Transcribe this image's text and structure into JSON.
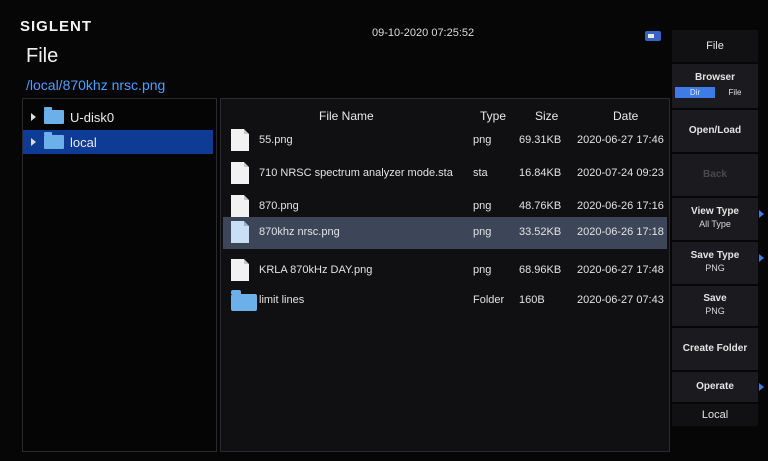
{
  "header": {
    "brand": "SIGLENT",
    "datetime": "09-10-2020 07:25:52",
    "title": "File",
    "path": "/local/870khz nrsc.png",
    "usb_icon": "usb-icon"
  },
  "tree": {
    "items": [
      {
        "label": "U-disk0",
        "selected": false
      },
      {
        "label": "local",
        "selected": true
      }
    ]
  },
  "columns": {
    "name": "File Name",
    "type": "Type",
    "size": "Size",
    "date": "Date"
  },
  "files": [
    {
      "name": "55.png",
      "type": "png",
      "size": "69.31KB",
      "date": "2020-06-27 17:46",
      "kind": "file"
    },
    {
      "name": "710 NRSC spectrum analyzer mode.sta",
      "type": "sta",
      "size": "16.84KB",
      "date": "2020-07-24 09:23",
      "kind": "file"
    },
    {
      "name": "870.png",
      "type": "png",
      "size": "48.76KB",
      "date": "2020-06-26 17:16",
      "kind": "file"
    },
    {
      "name": "870khz nrsc.png",
      "type": "png",
      "size": "33.52KB",
      "date": "2020-06-26 17:18",
      "kind": "file",
      "selected": true
    },
    {
      "name": "KRLA 870kHz DAY.png",
      "type": "png",
      "size": "68.96KB",
      "date": "2020-06-27 17:48",
      "kind": "file"
    },
    {
      "name": "limit lines",
      "type": "Folder",
      "size": "160B",
      "date": "2020-06-27 07:43",
      "kind": "folder"
    }
  ],
  "menu": {
    "title": "File",
    "browser": {
      "label": "Browser",
      "dir": "Dir",
      "file": "File"
    },
    "open_load": "Open/Load",
    "back": "Back",
    "view_type": {
      "label": "View Type",
      "value": "All Type"
    },
    "save_type": {
      "label": "Save Type",
      "value": "PNG"
    },
    "save": {
      "label": "Save",
      "value": "PNG"
    },
    "create_folder": "Create Folder",
    "operate": "Operate",
    "local": "Local"
  },
  "colors": {
    "accent": "#3e7be6",
    "path_text": "#4d9fff",
    "selection": "#0e3c94",
    "row_selection": "#3d4658"
  }
}
